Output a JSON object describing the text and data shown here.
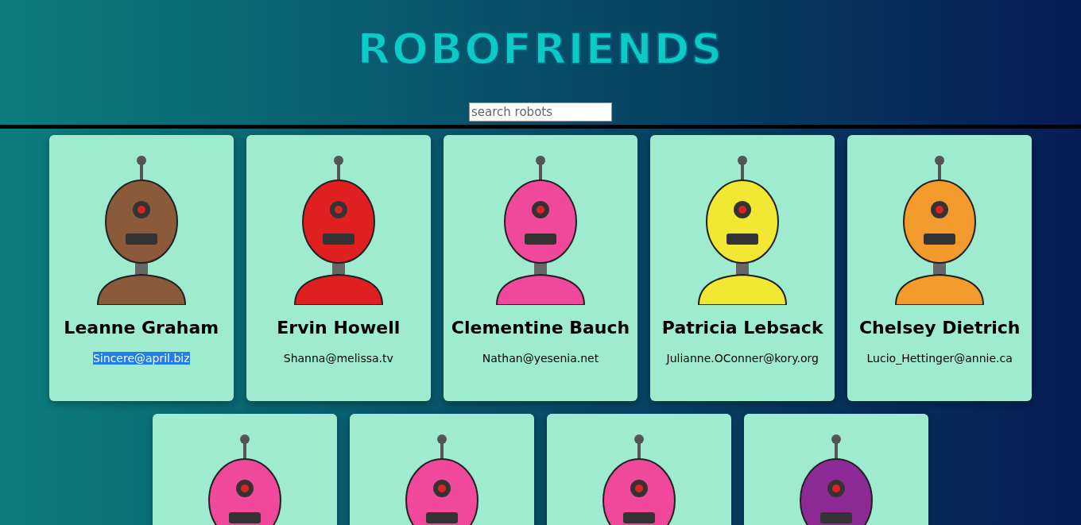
{
  "header": {
    "title": "ROBOFRIENDS",
    "search": {
      "placeholder": "search robots"
    }
  },
  "robots": [
    {
      "name": "Leanne Graham",
      "email": "Sincere@april.biz",
      "email_selected": true,
      "color": "#8a5a3a"
    },
    {
      "name": "Ervin Howell",
      "email": "Shanna@melissa.tv",
      "email_selected": false,
      "color": "#e02020"
    },
    {
      "name": "Clementine Bauch",
      "email": "Nathan@yesenia.net",
      "email_selected": false,
      "color": "#f0489a"
    },
    {
      "name": "Patricia Lebsack",
      "email": "Julianne.OConner@kory.org",
      "email_selected": false,
      "color": "#f2e834"
    },
    {
      "name": "Chelsey Dietrich",
      "email": "Lucio_Hettinger@annie.ca",
      "email_selected": false,
      "color": "#f39a2c"
    },
    {
      "color": "#f0489a"
    },
    {
      "color": "#f0489a"
    },
    {
      "color": "#f0489a"
    },
    {
      "color": "#8e2a96"
    }
  ]
}
